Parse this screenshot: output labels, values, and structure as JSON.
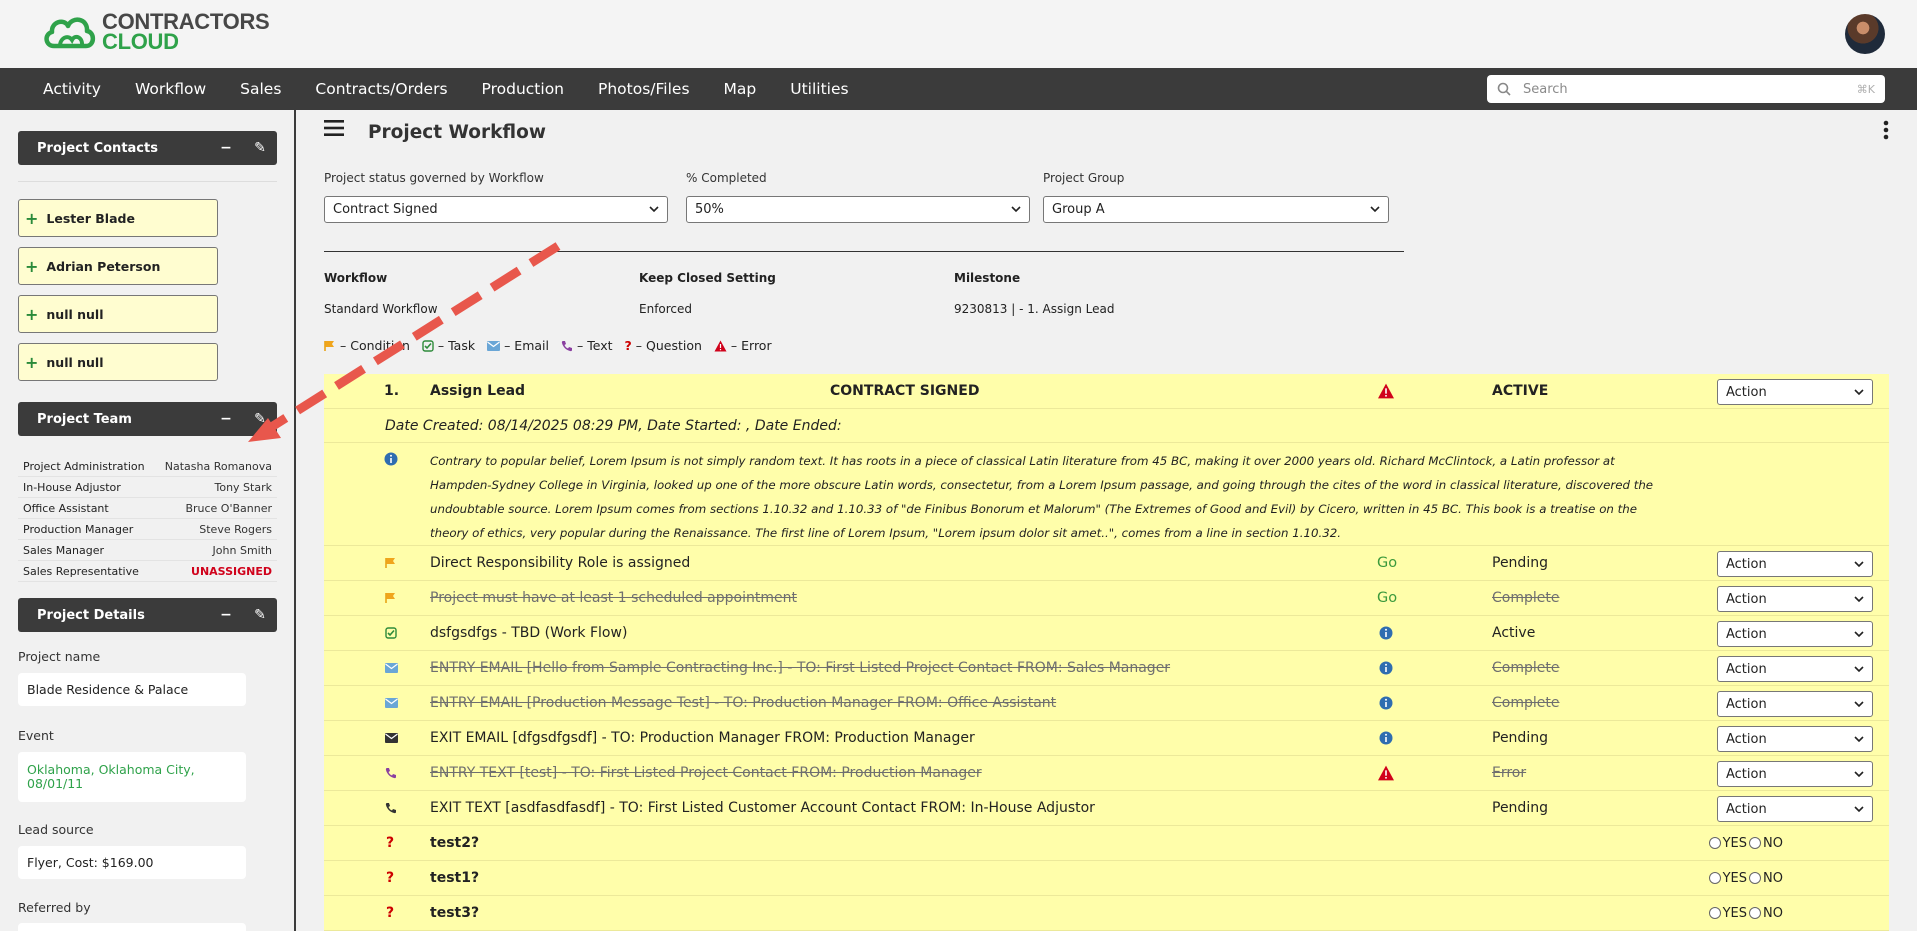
{
  "brand": {
    "line1": "CONTRACTORS",
    "line2": "CLOUD",
    "green": "#2fa24a"
  },
  "nav": {
    "items": [
      "Activity",
      "Workflow",
      "Sales",
      "Contracts/Orders",
      "Production",
      "Photos/Files",
      "Map",
      "Utilities"
    ]
  },
  "search": {
    "placeholder": "Search",
    "shortcut": "⌘K"
  },
  "sidebar": {
    "contacts_title": "Project Contacts",
    "contacts": [
      "Lester Blade",
      "Adrian Peterson",
      "null null",
      "null null"
    ],
    "team_title": "Project Team",
    "team": [
      {
        "role": "Project Administration",
        "name": "Natasha Romanova"
      },
      {
        "role": "In-House Adjustor",
        "name": "Tony Stark"
      },
      {
        "role": "Office Assistant",
        "name": "Bruce O'Banner"
      },
      {
        "role": "Production Manager",
        "name": "Steve Rogers"
      },
      {
        "role": "Sales Manager",
        "name": "John Smith"
      },
      {
        "role": "Sales Representative",
        "name": "UNASSIGNED"
      }
    ],
    "details_title": "Project Details",
    "fields": {
      "project_name_label": "Project name",
      "project_name": "Blade Residence & Palace",
      "event_label": "Event",
      "event": "Oklahoma, Oklahoma City, 08/01/11",
      "lead_source_label": "Lead source",
      "lead_source": "Flyer, Cost: $169.00",
      "referred_by_label": "Referred by"
    }
  },
  "main": {
    "title": "Project Workflow",
    "status_label": "Project status governed by Workflow",
    "status_value": "Contract Signed",
    "completed_label": "% Completed",
    "completed_value": "50%",
    "group_label": "Project Group",
    "group_value": "Group A",
    "workflow_h": "Workflow",
    "workflow_v": "Standard Workflow",
    "keep_h": "Keep Closed Setting",
    "keep_v": "Enforced",
    "milestone_h": "Milestone",
    "milestone_v": "9230813 | - 1. Assign Lead",
    "legend": {
      "condition": "– Condition",
      "task": "– Task",
      "email": "– Email",
      "text": "– Text",
      "question": "– Question",
      "error": "– Error"
    }
  },
  "workflow": {
    "step_num": "1.",
    "step_name": "Assign Lead",
    "step_status_title": "CONTRACT SIGNED",
    "step_state": "ACTIVE",
    "action_label": "Action",
    "dates": "Date Created: 08/14/2025 08:29 PM, Date Started: , Date Ended:",
    "description": "Contrary to popular belief, Lorem Ipsum is not simply random text. It has roots in a piece of classical Latin literature from 45 BC, making it over 2000 years old. Richard McClintock, a Latin professor at Hampden-Sydney College in Virginia, looked up one of the more obscure Latin words, consectetur, from a Lorem Ipsum passage, and going through the cites of the word in classical literature, discovered the undoubtable source. Lorem Ipsum comes from sections 1.10.32 and 1.10.33 of \"de Finibus Bonorum et Malorum\" (The Extremes of Good and Evil) by Cicero, written in 45 BC. This book is a treatise on the theory of ethics, very popular during the Renaissance. The first line of Lorem Ipsum, \"Lorem ipsum dolor sit amet..\", comes from a line in section 1.10.32.",
    "items": [
      {
        "text": "Direct Responsibility Role is assigned",
        "go": "Go",
        "status": "Pending"
      },
      {
        "text": "Project must have at least 1 scheduled appointment",
        "go": "Go",
        "status": "Complete"
      },
      {
        "text": "dsfgsdfgs - TBD (Work Flow)",
        "status": "Active"
      },
      {
        "text": "ENTRY EMAIL [Hello from Sample Contracting Inc.] - TO: First Listed Project Contact FROM: Sales Manager",
        "status": "Complete"
      },
      {
        "text": "ENTRY EMAIL [Production Message Test] - TO: Production Manager FROM: Office Assistant",
        "status": "Complete"
      },
      {
        "text": "EXIT EMAIL [dfgsdfgsdf] - TO: Production Manager FROM: Production Manager",
        "status": "Pending"
      },
      {
        "text": "ENTRY TEXT [test] - TO: First Listed Project Contact FROM: Production Manager",
        "status": "Error"
      },
      {
        "text": "EXIT TEXT [asdfasdfasdf] - TO: First Listed Customer Account Contact FROM: In-House Adjustor",
        "status": "Pending"
      }
    ],
    "questions": [
      "test2?",
      "test1?",
      "test3?"
    ],
    "yes": "YES",
    "no": "NO"
  }
}
